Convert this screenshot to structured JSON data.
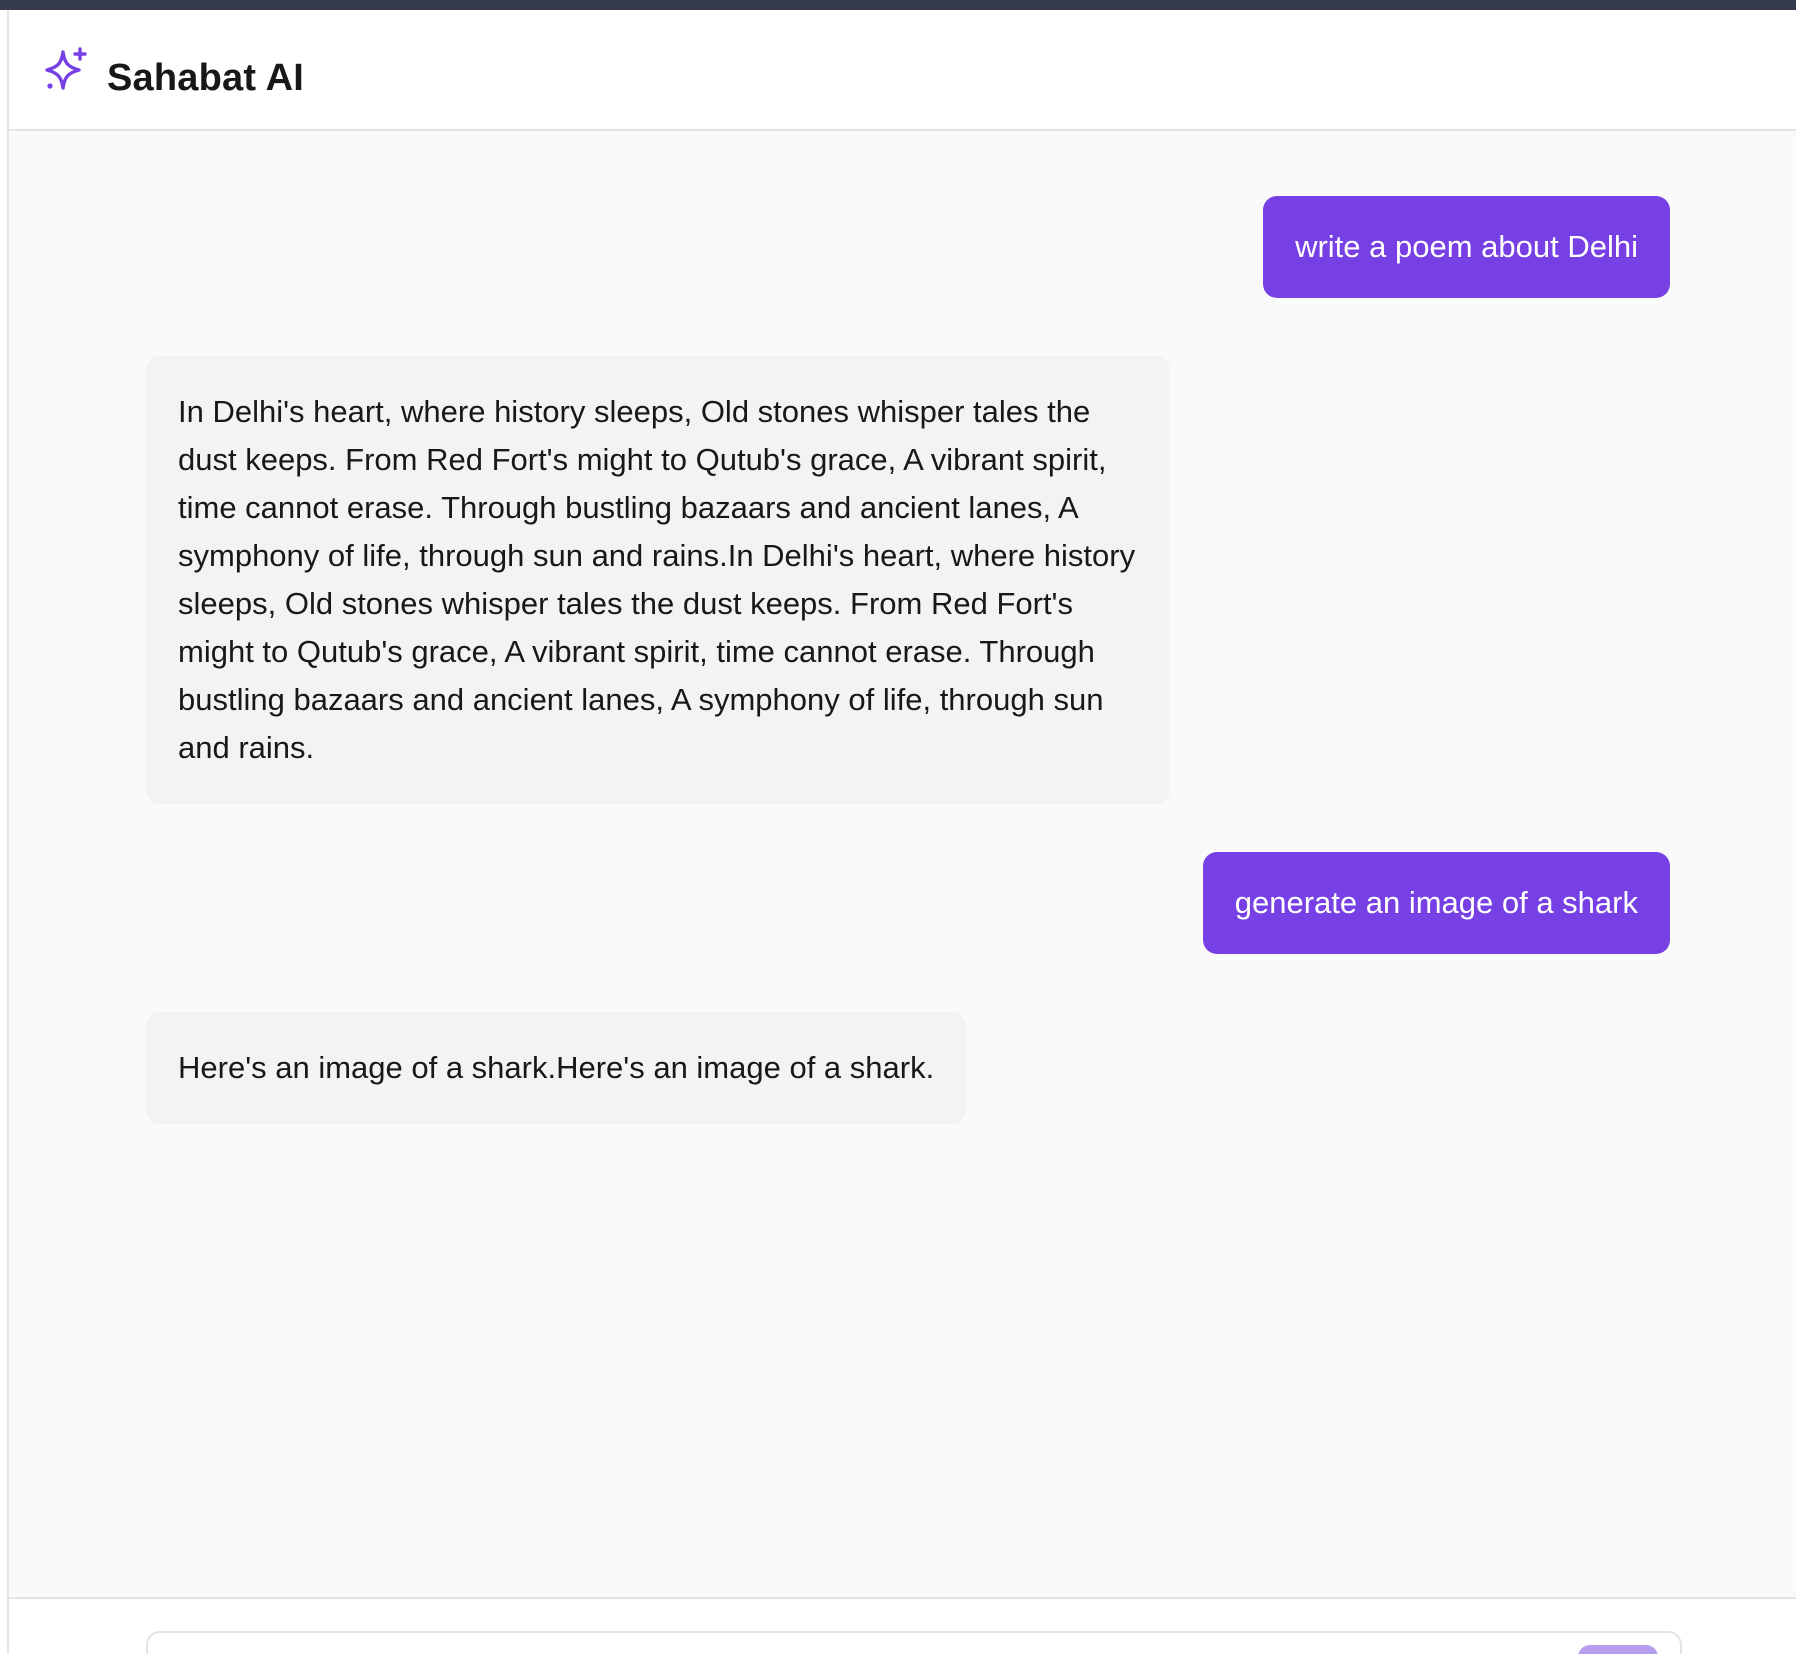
{
  "app": {
    "title": "Sahabat AI",
    "logo_icon": "sparkles-icon",
    "accent_color": "#7640e4"
  },
  "messages": [
    {
      "role": "user",
      "text": "write a poem about Delhi"
    },
    {
      "role": "assistant",
      "text": "In Delhi's heart, where history sleeps, Old stones whisper tales the dust keeps. From Red Fort's might to Qutub's grace, A vibrant spirit, time cannot erase. Through bustling bazaars and ancient lanes, A symphony of life, through sun and rains.In Delhi's heart, where history sleeps, Old stones whisper tales the dust keeps. From Red Fort's might to Qutub's grace, A vibrant spirit, time cannot erase. Through bustling bazaars and ancient lanes, A symphony of life, through sun and rains."
    },
    {
      "role": "user",
      "text": "generate an image of a shark"
    },
    {
      "role": "assistant",
      "text": "Here's an image of a shark.Here's an image of a shark."
    }
  ],
  "composer": {
    "value": "",
    "send_icon": "send-icon"
  }
}
